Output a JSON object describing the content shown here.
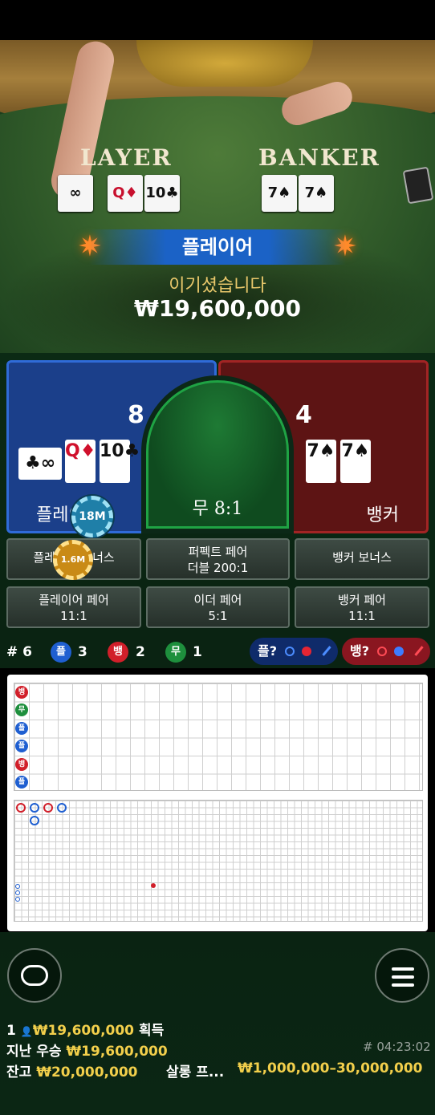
{
  "video": {
    "player_label": "LAYER",
    "banker_label": "BANKER",
    "player_cards": [
      "∞",
      "Q♦",
      "10♣"
    ],
    "banker_cards": [
      "7♠",
      "7♠"
    ],
    "win_side": "플레이어",
    "win_text": "이기셨습니다",
    "win_amount": "₩19,600,000"
  },
  "bet": {
    "player": {
      "label": "플레이어",
      "score": "8",
      "cards": [
        "♣∞",
        "Q♦",
        "10♣"
      ],
      "chip": "18M"
    },
    "banker": {
      "label": "뱅커",
      "score": "4",
      "cards": [
        "7♠",
        "7♠"
      ]
    },
    "tie": {
      "label": "무 8:1"
    },
    "buttons": [
      {
        "label": "플레이어 보너스",
        "odds": "",
        "chip": "1.6M"
      },
      {
        "label": "퍼펙트 페어",
        "odds": "더블 200:1"
      },
      {
        "label": "뱅커 보너스",
        "odds": ""
      },
      {
        "label": "플레이어 페어",
        "odds": "11:1"
      },
      {
        "label": "이더 페어",
        "odds": "5:1"
      },
      {
        "label": "뱅커 페어",
        "odds": "11:1"
      }
    ]
  },
  "stats": {
    "round_count": "# 6",
    "player_badge": "플",
    "player_count": "3",
    "banker_badge": "뱅",
    "banker_count": "2",
    "tie_badge": "무",
    "tie_count": "1",
    "ask_player": "플?",
    "ask_banker": "뱅?"
  },
  "roadmap": {
    "bead_column": [
      "뱅",
      "무",
      "플",
      "플",
      "뱅",
      "플"
    ]
  },
  "bottom": {
    "players": "1",
    "player_win": "₩19,600,000",
    "win_suffix": "획득",
    "last_winner_label": "지난 우승",
    "last_winner_amount": "₩19,600,000",
    "round_id": "# 04:23:02",
    "balance_label": "잔고",
    "balance": "₩20,000,000",
    "table_name": "살롱 프...",
    "limits": "₩1,000,000–30,000,000"
  },
  "colors": {
    "player": "#1f5fd1",
    "banker": "#d11f2a",
    "tie": "#1e8f3d",
    "gold": "#f2cf4b"
  }
}
